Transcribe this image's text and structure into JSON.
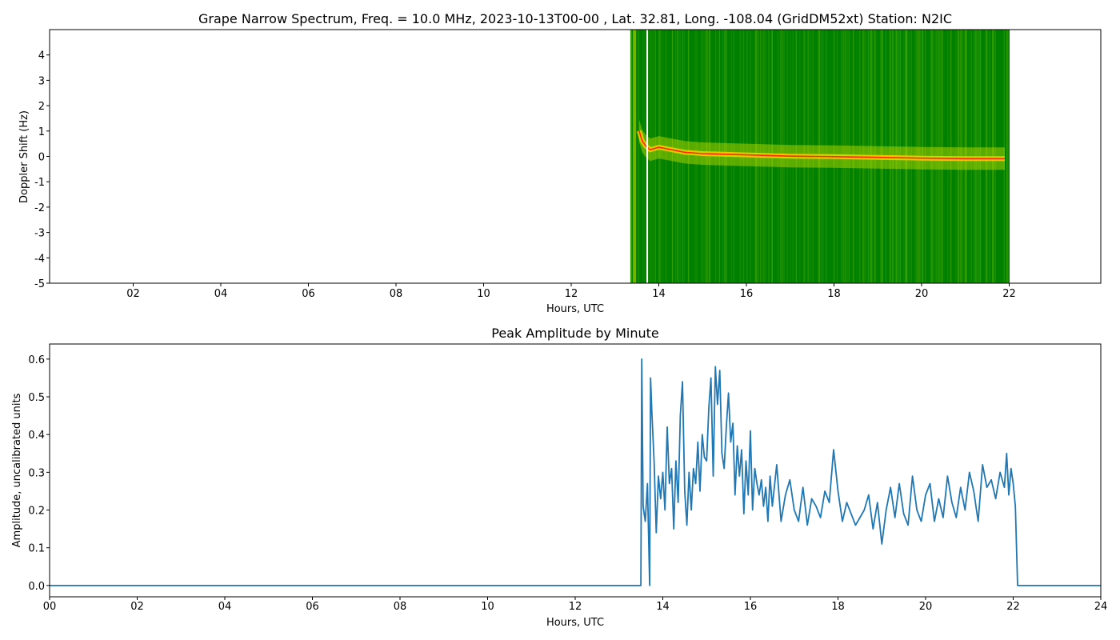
{
  "chart_data": [
    {
      "type": "heatmap",
      "title": "Grape Narrow Spectrum, Freq. = 10.0 MHz, 2023-10-13T00-00 , Lat.  32.81, Long. -108.04 (GridDM52xt) Station: N2IC",
      "xlabel": "Hours, UTC",
      "ylabel": "Doppler Shift (Hz)",
      "xlim": [
        0,
        24
      ],
      "ylim": [
        -5,
        5
      ],
      "xticks": [
        "02",
        "04",
        "06",
        "08",
        "10",
        "12",
        "14",
        "16",
        "18",
        "20",
        "22"
      ],
      "yticks": [
        "4",
        "3",
        "2",
        "1",
        "0",
        "-1",
        "-2",
        "-3",
        "-4",
        "-5"
      ],
      "data_span_hours": [
        13.5,
        21.9
      ],
      "gap_hours": 13.7,
      "background_color": "#008000",
      "trace_color": "#ff2a00",
      "noise_color": "#c8e000",
      "trace": {
        "hours": [
          13.55,
          13.62,
          13.7,
          13.8,
          14.0,
          14.3,
          14.6,
          15.0,
          16.0,
          17.0,
          18.0,
          19.0,
          20.0,
          21.0,
          21.9
        ],
        "doppler_hz": [
          1.2,
          0.8,
          0.6,
          0.45,
          0.55,
          0.45,
          0.35,
          0.3,
          0.25,
          0.2,
          0.18,
          0.15,
          0.12,
          0.1,
          0.1
        ]
      }
    },
    {
      "type": "line",
      "title": "Peak Amplitude by Minute",
      "xlabel": "Hours, UTC",
      "ylabel": "Amplitude, uncalibrated units",
      "xlim": [
        0,
        24
      ],
      "ylim": [
        -0.03,
        0.64
      ],
      "xticks": [
        "00",
        "02",
        "04",
        "06",
        "08",
        "10",
        "12",
        "14",
        "16",
        "18",
        "20",
        "22",
        "24"
      ],
      "yticks": [
        "0.0",
        "0.1",
        "0.2",
        "0.3",
        "0.4",
        "0.5",
        "0.6"
      ],
      "line_color": "#1f77b4",
      "series": [
        {
          "x": [
            0,
            13.5,
            13.52,
            13.55,
            13.6,
            13.65,
            13.7,
            13.72,
            13.75,
            13.8,
            13.85,
            13.9,
            13.95,
            14.0,
            14.05,
            14.1,
            14.15,
            14.2,
            14.25,
            14.3,
            14.35,
            14.4,
            14.45,
            14.5,
            14.55,
            14.6,
            14.65,
            14.7,
            14.75,
            14.8,
            14.85,
            14.9,
            14.95,
            15.0,
            15.05,
            15.1,
            15.15,
            15.2,
            15.25,
            15.3,
            15.35,
            15.4,
            15.45,
            15.5,
            15.55,
            15.6,
            15.65,
            15.7,
            15.75,
            15.8,
            15.85,
            15.9,
            15.95,
            16.0,
            16.05,
            16.1,
            16.15,
            16.2,
            16.25,
            16.3,
            16.35,
            16.4,
            16.45,
            16.5,
            16.6,
            16.7,
            16.8,
            16.9,
            17.0,
            17.1,
            17.2,
            17.3,
            17.4,
            17.5,
            17.6,
            17.7,
            17.8,
            17.9,
            18.0,
            18.1,
            18.2,
            18.3,
            18.4,
            18.5,
            18.6,
            18.7,
            18.8,
            18.9,
            19.0,
            19.1,
            19.2,
            19.3,
            19.4,
            19.5,
            19.6,
            19.7,
            19.8,
            19.9,
            20.0,
            20.1,
            20.2,
            20.3,
            20.4,
            20.5,
            20.6,
            20.7,
            20.8,
            20.9,
            21.0,
            21.1,
            21.2,
            21.3,
            21.4,
            21.5,
            21.6,
            21.7,
            21.8,
            21.85,
            21.9,
            21.95,
            22.0,
            22.05,
            22.1,
            22.12,
            24
          ],
          "y": [
            0,
            0,
            0.6,
            0.21,
            0.17,
            0.27,
            0.0,
            0.55,
            0.46,
            0.33,
            0.14,
            0.29,
            0.23,
            0.3,
            0.2,
            0.42,
            0.27,
            0.31,
            0.15,
            0.33,
            0.22,
            0.45,
            0.54,
            0.25,
            0.16,
            0.3,
            0.2,
            0.31,
            0.27,
            0.38,
            0.25,
            0.4,
            0.34,
            0.33,
            0.47,
            0.55,
            0.29,
            0.58,
            0.48,
            0.57,
            0.35,
            0.31,
            0.42,
            0.51,
            0.38,
            0.43,
            0.24,
            0.37,
            0.29,
            0.36,
            0.19,
            0.33,
            0.24,
            0.41,
            0.2,
            0.31,
            0.27,
            0.24,
            0.28,
            0.21,
            0.26,
            0.17,
            0.29,
            0.21,
            0.32,
            0.17,
            0.24,
            0.28,
            0.2,
            0.17,
            0.26,
            0.16,
            0.23,
            0.21,
            0.18,
            0.25,
            0.22,
            0.36,
            0.25,
            0.17,
            0.22,
            0.19,
            0.16,
            0.18,
            0.2,
            0.24,
            0.15,
            0.22,
            0.11,
            0.2,
            0.26,
            0.18,
            0.27,
            0.19,
            0.16,
            0.29,
            0.2,
            0.17,
            0.24,
            0.27,
            0.17,
            0.23,
            0.18,
            0.29,
            0.22,
            0.18,
            0.26,
            0.2,
            0.3,
            0.25,
            0.17,
            0.32,
            0.26,
            0.28,
            0.23,
            0.3,
            0.26,
            0.35,
            0.24,
            0.31,
            0.27,
            0.21,
            0.0,
            0,
            0
          ]
        }
      ]
    }
  ]
}
